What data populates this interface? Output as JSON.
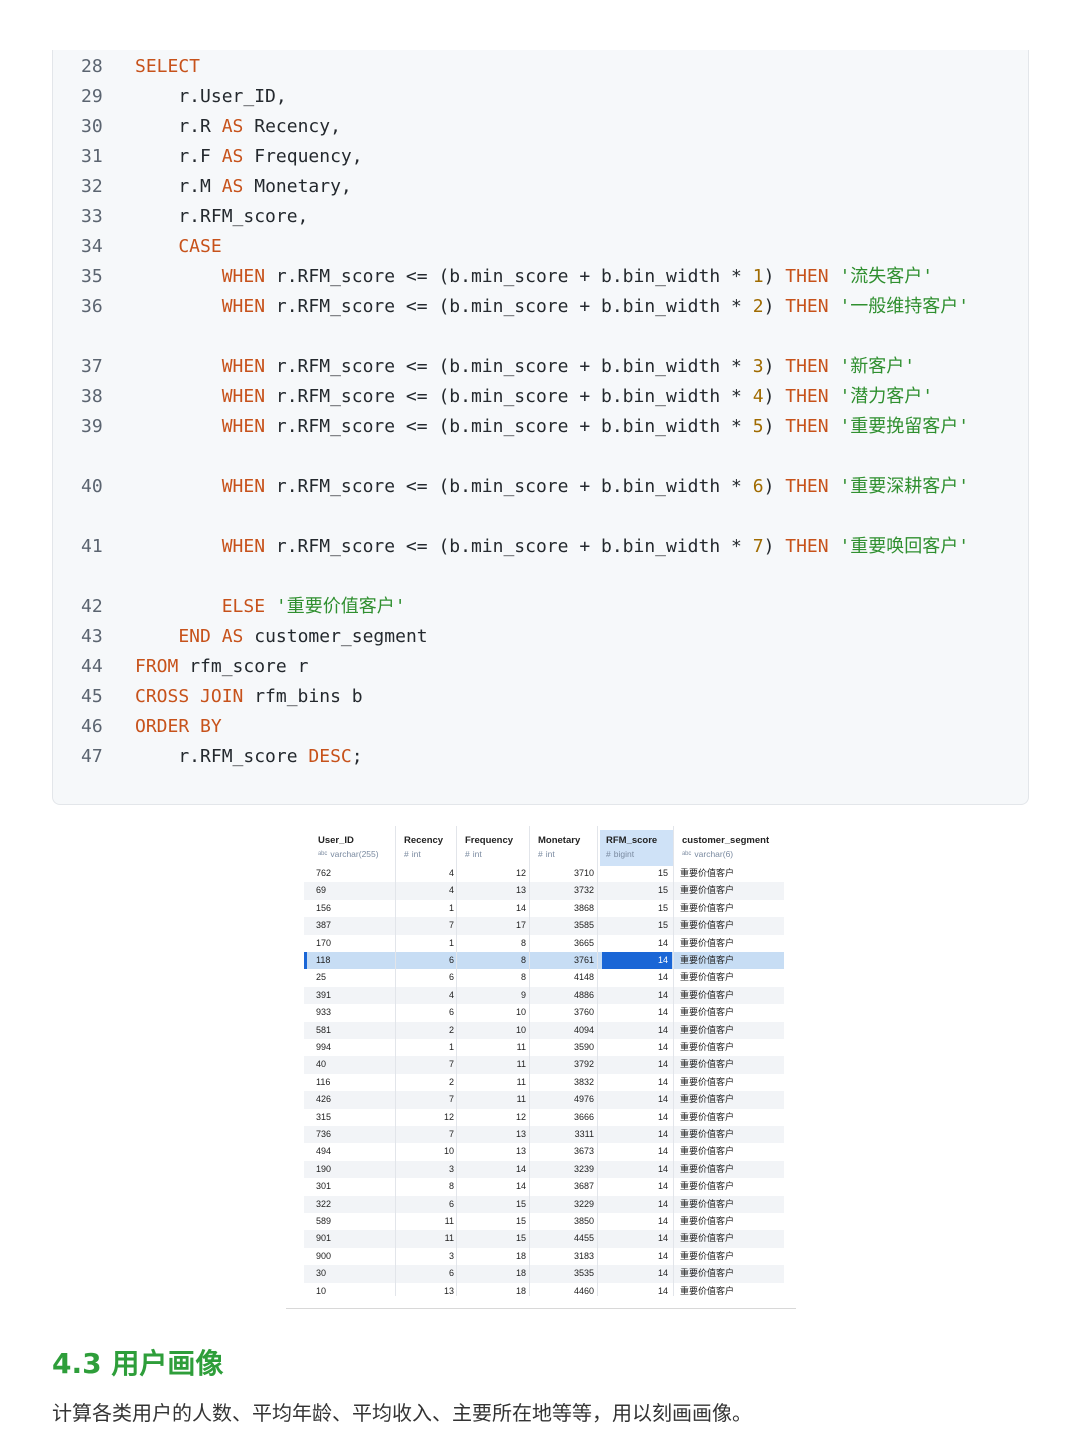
{
  "code": {
    "lines": [
      {
        "n": "28",
        "parts": [
          [
            "kw",
            "SELECT"
          ]
        ]
      },
      {
        "n": "29",
        "parts": [
          [
            "",
            "    r.User_ID,"
          ]
        ]
      },
      {
        "n": "30",
        "parts": [
          [
            "",
            "    r.R "
          ],
          [
            "kw",
            "AS"
          ],
          [
            "",
            " Recency,"
          ]
        ]
      },
      {
        "n": "31",
        "parts": [
          [
            "",
            "    r.F "
          ],
          [
            "kw",
            "AS"
          ],
          [
            "",
            " Frequency,"
          ]
        ]
      },
      {
        "n": "32",
        "parts": [
          [
            "",
            "    r.M "
          ],
          [
            "kw",
            "AS"
          ],
          [
            "",
            " Monetary,"
          ]
        ]
      },
      {
        "n": "33",
        "parts": [
          [
            "",
            "    r.RFM_score,"
          ]
        ]
      },
      {
        "n": "34",
        "parts": [
          [
            "kw",
            "    CASE"
          ]
        ]
      },
      {
        "n": "35",
        "parts": [
          [
            "kw",
            "        WHEN"
          ],
          [
            "",
            " r.RFM_score <= (b.min_score + b.bin_width * "
          ],
          [
            "num",
            "1"
          ],
          [
            "",
            ") "
          ],
          [
            "kw",
            "THEN"
          ],
          [
            "",
            " "
          ],
          [
            "str",
            "'流失客户'"
          ]
        ]
      },
      {
        "n": "36",
        "parts": [
          [
            "kw",
            "        WHEN"
          ],
          [
            "",
            " r.RFM_score <= (b.min_score + b.bin_width * "
          ],
          [
            "num",
            "2"
          ],
          [
            "",
            ") "
          ],
          [
            "kw",
            "THEN"
          ],
          [
            "",
            " "
          ],
          [
            "str",
            "'一般维持客户'"
          ]
        ]
      },
      {
        "n": "37",
        "parts": [
          [
            "kw",
            "        WHEN"
          ],
          [
            "",
            " r.RFM_score <= (b.min_score + b.bin_width * "
          ],
          [
            "num",
            "3"
          ],
          [
            "",
            ") "
          ],
          [
            "kw",
            "THEN"
          ],
          [
            "",
            " "
          ],
          [
            "str",
            "'新客户'"
          ]
        ]
      },
      {
        "n": "38",
        "parts": [
          [
            "kw",
            "        WHEN"
          ],
          [
            "",
            " r.RFM_score <= (b.min_score + b.bin_width * "
          ],
          [
            "num",
            "4"
          ],
          [
            "",
            ") "
          ],
          [
            "kw",
            "THEN"
          ],
          [
            "",
            " "
          ],
          [
            "str",
            "'潜力客户'"
          ]
        ]
      },
      {
        "n": "39",
        "parts": [
          [
            "kw",
            "        WHEN"
          ],
          [
            "",
            " r.RFM_score <= (b.min_score + b.bin_width * "
          ],
          [
            "num",
            "5"
          ],
          [
            "",
            ") "
          ],
          [
            "kw",
            "THEN"
          ],
          [
            "",
            " "
          ],
          [
            "str",
            "'重要挽留客户'"
          ]
        ]
      },
      {
        "n": "40",
        "parts": [
          [
            "kw",
            "        WHEN"
          ],
          [
            "",
            " r.RFM_score <= (b.min_score + b.bin_width * "
          ],
          [
            "num",
            "6"
          ],
          [
            "",
            ") "
          ],
          [
            "kw",
            "THEN"
          ],
          [
            "",
            " "
          ],
          [
            "str",
            "'重要深耕客户'"
          ]
        ]
      },
      {
        "n": "41",
        "parts": [
          [
            "kw",
            "        WHEN"
          ],
          [
            "",
            " r.RFM_score <= (b.min_score + b.bin_width * "
          ],
          [
            "num",
            "7"
          ],
          [
            "",
            ") "
          ],
          [
            "kw",
            "THEN"
          ],
          [
            "",
            " "
          ],
          [
            "str",
            "'重要唤回客户'"
          ]
        ]
      },
      {
        "n": "42",
        "parts": [
          [
            "kw",
            "        ELSE"
          ],
          [
            "",
            " "
          ],
          [
            "str",
            "'重要价值客户'"
          ]
        ]
      },
      {
        "n": "43",
        "parts": [
          [
            "kw",
            "    END"
          ],
          [
            "",
            " "
          ],
          [
            "kw",
            "AS"
          ],
          [
            "",
            " customer_segment"
          ]
        ]
      },
      {
        "n": "44",
        "parts": [
          [
            "kw",
            "FROM"
          ],
          [
            "",
            " rfm_score r"
          ]
        ]
      },
      {
        "n": "45",
        "parts": [
          [
            "kw",
            "CROSS JOIN"
          ],
          [
            "",
            " rfm_bins b"
          ]
        ]
      },
      {
        "n": "46",
        "parts": [
          [
            "kw",
            "ORDER BY"
          ]
        ]
      },
      {
        "n": "47",
        "parts": [
          [
            "",
            "    r.RFM_score "
          ],
          [
            "kw",
            "DESC"
          ],
          [
            "",
            ";"
          ]
        ]
      }
    ]
  },
  "table": {
    "columns": [
      {
        "name": "User_ID",
        "type": "varchar(255)",
        "type_icon": "abc"
      },
      {
        "name": "Recency",
        "type": "int",
        "type_icon": "#"
      },
      {
        "name": "Frequency",
        "type": "int",
        "type_icon": "#"
      },
      {
        "name": "Monetary",
        "type": "int",
        "type_icon": "#"
      },
      {
        "name": "RFM_score",
        "type": "bigint",
        "type_icon": "#"
      },
      {
        "name": "customer_segment",
        "type": "varchar(6)",
        "type_icon": "abc"
      }
    ],
    "rows": [
      [
        "762",
        "4",
        "12",
        "3710",
        "15",
        "重要价值客户"
      ],
      [
        "69",
        "4",
        "13",
        "3732",
        "15",
        "重要价值客户"
      ],
      [
        "156",
        "1",
        "14",
        "3868",
        "15",
        "重要价值客户"
      ],
      [
        "387",
        "7",
        "17",
        "3585",
        "15",
        "重要价值客户"
      ],
      [
        "170",
        "1",
        "8",
        "3665",
        "14",
        "重要价值客户"
      ],
      [
        "118",
        "6",
        "8",
        "3761",
        "14",
        "重要价值客户"
      ],
      [
        "25",
        "6",
        "8",
        "4148",
        "14",
        "重要价值客户"
      ],
      [
        "391",
        "4",
        "9",
        "4886",
        "14",
        "重要价值客户"
      ],
      [
        "933",
        "6",
        "10",
        "3760",
        "14",
        "重要价值客户"
      ],
      [
        "581",
        "2",
        "10",
        "4094",
        "14",
        "重要价值客户"
      ],
      [
        "994",
        "1",
        "11",
        "3590",
        "14",
        "重要价值客户"
      ],
      [
        "40",
        "7",
        "11",
        "3792",
        "14",
        "重要价值客户"
      ],
      [
        "116",
        "2",
        "11",
        "3832",
        "14",
        "重要价值客户"
      ],
      [
        "426",
        "7",
        "11",
        "4976",
        "14",
        "重要价值客户"
      ],
      [
        "315",
        "12",
        "12",
        "3666",
        "14",
        "重要价值客户"
      ],
      [
        "736",
        "7",
        "13",
        "3311",
        "14",
        "重要价值客户"
      ],
      [
        "494",
        "10",
        "13",
        "3673",
        "14",
        "重要价值客户"
      ],
      [
        "190",
        "3",
        "14",
        "3239",
        "14",
        "重要价值客户"
      ],
      [
        "301",
        "8",
        "14",
        "3687",
        "14",
        "重要价值客户"
      ],
      [
        "322",
        "6",
        "15",
        "3229",
        "14",
        "重要价值客户"
      ],
      [
        "589",
        "11",
        "15",
        "3850",
        "14",
        "重要价值客户"
      ],
      [
        "901",
        "11",
        "15",
        "4455",
        "14",
        "重要价值客户"
      ],
      [
        "900",
        "3",
        "18",
        "3183",
        "14",
        "重要价值客户"
      ],
      [
        "30",
        "6",
        "18",
        "3535",
        "14",
        "重要价值客户"
      ],
      [
        "10",
        "13",
        "18",
        "4460",
        "14",
        "重要价值客户"
      ]
    ],
    "selected_row_index": 5
  },
  "section": {
    "title": "4.3 用户画像",
    "text": "计算各类用户的人数、平均年龄、平均收入、主要所在地等等，用以刻画画像。"
  },
  "colors": {
    "keyword": "#c7521b",
    "string": "#2f8f2f",
    "number": "#a06b00",
    "heading": "#2e9e3a",
    "selection": "#1a66d6"
  }
}
